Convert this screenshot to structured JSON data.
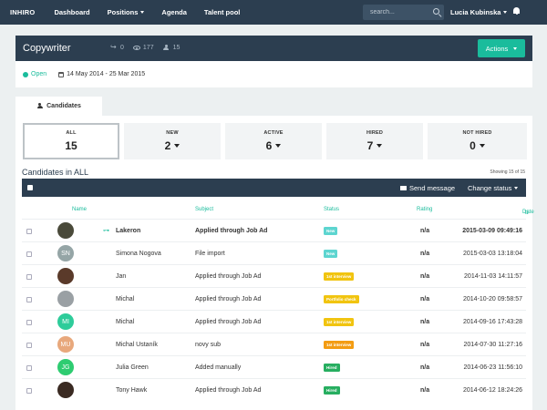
{
  "nav": {
    "brand": "INHIRO",
    "items": [
      "Dashboard",
      "Positions",
      "Agenda",
      "Talent pool"
    ],
    "search_placeholder": "search...",
    "user": "Lucia Kubinska"
  },
  "position": {
    "title": "Copywriter",
    "shares": "0",
    "views": "177",
    "candidates": "15",
    "actions_label": "Actions",
    "status": "Open",
    "date_range": "14 May 2014 - 25 Mar 2015"
  },
  "tab": {
    "label": "Candidates"
  },
  "cards": [
    {
      "label": "ALL",
      "count": "15"
    },
    {
      "label": "NEW",
      "count": "2"
    },
    {
      "label": "ACTIVE",
      "count": "6"
    },
    {
      "label": "HIRED",
      "count": "7"
    },
    {
      "label": "NOT HIRED",
      "count": "0"
    }
  ],
  "list": {
    "title": "Candidates in ALL",
    "showing": "Showing 15 of 15",
    "send_message": "Send message",
    "change_status": "Change status"
  },
  "columns": {
    "name": "Name",
    "subject": "Subject",
    "status": "Status",
    "rating": "Rating",
    "date": "Date"
  },
  "colors": {
    "nav": "#2c3e50",
    "accent": "#1abc9c",
    "status_new": "#48d1cc",
    "status_interview": "#f1c40f",
    "status_hired": "#27ae60"
  },
  "rows": [
    {
      "name": "Lakeron",
      "initials": "",
      "avatar_color": "#4a4a3a",
      "subject": "Applied through Job Ad",
      "status": "New",
      "status_color": "#5dd5d0",
      "rating": "n/a",
      "date": "2015-03-09 09:49:16",
      "bold": true
    },
    {
      "name": "Simona Nogova",
      "initials": "SN",
      "avatar_color": "#95a5a6",
      "subject": "File import",
      "status": "New",
      "status_color": "#5dd5d0",
      "rating": "n/a",
      "date": "2015-03-03 13:18:04",
      "bold": false
    },
    {
      "name": "Jan",
      "initials": "",
      "avatar_color": "#5a3a2a",
      "subject": "Applied through Job Ad",
      "status": "1st interview",
      "status_color": "#f1c40f",
      "rating": "n/a",
      "date": "2014-11-03 14:11:57",
      "bold": false
    },
    {
      "name": "Michal",
      "initials": "",
      "avatar_color": "#9aa0a4",
      "subject": "Applied through Job Ad",
      "status": "Portfolio check",
      "status_color": "#f1c40f",
      "rating": "n/a",
      "date": "2014-10-20 09:58:57",
      "bold": false
    },
    {
      "name": "Michal",
      "initials": "MI",
      "avatar_color": "#2ecc9a",
      "subject": "Applied through Job Ad",
      "status": "1st interview",
      "status_color": "#f1c40f",
      "rating": "n/a",
      "date": "2014-09-16 17:43:28",
      "bold": false
    },
    {
      "name": "Michal Ustaník",
      "initials": "MU",
      "avatar_color": "#e8a87c",
      "subject": "novy sub",
      "status": "1st interview",
      "status_color": "#f39c12",
      "rating": "n/a",
      "date": "2014-07-30 11:27:16",
      "bold": false
    },
    {
      "name": "Julia Green",
      "initials": "JG",
      "avatar_color": "#2ecc71",
      "subject": "Added manually",
      "status": "Hired",
      "status_color": "#27ae60",
      "rating": "n/a",
      "date": "2014-06-23 11:56:10",
      "bold": false
    },
    {
      "name": "Tony Hawk",
      "initials": "",
      "avatar_color": "#3a2a22",
      "subject": "Applied through Job Ad",
      "status": "Hired",
      "status_color": "#27ae60",
      "rating": "n/a",
      "date": "2014-06-12 18:24:26",
      "bold": false
    }
  ]
}
